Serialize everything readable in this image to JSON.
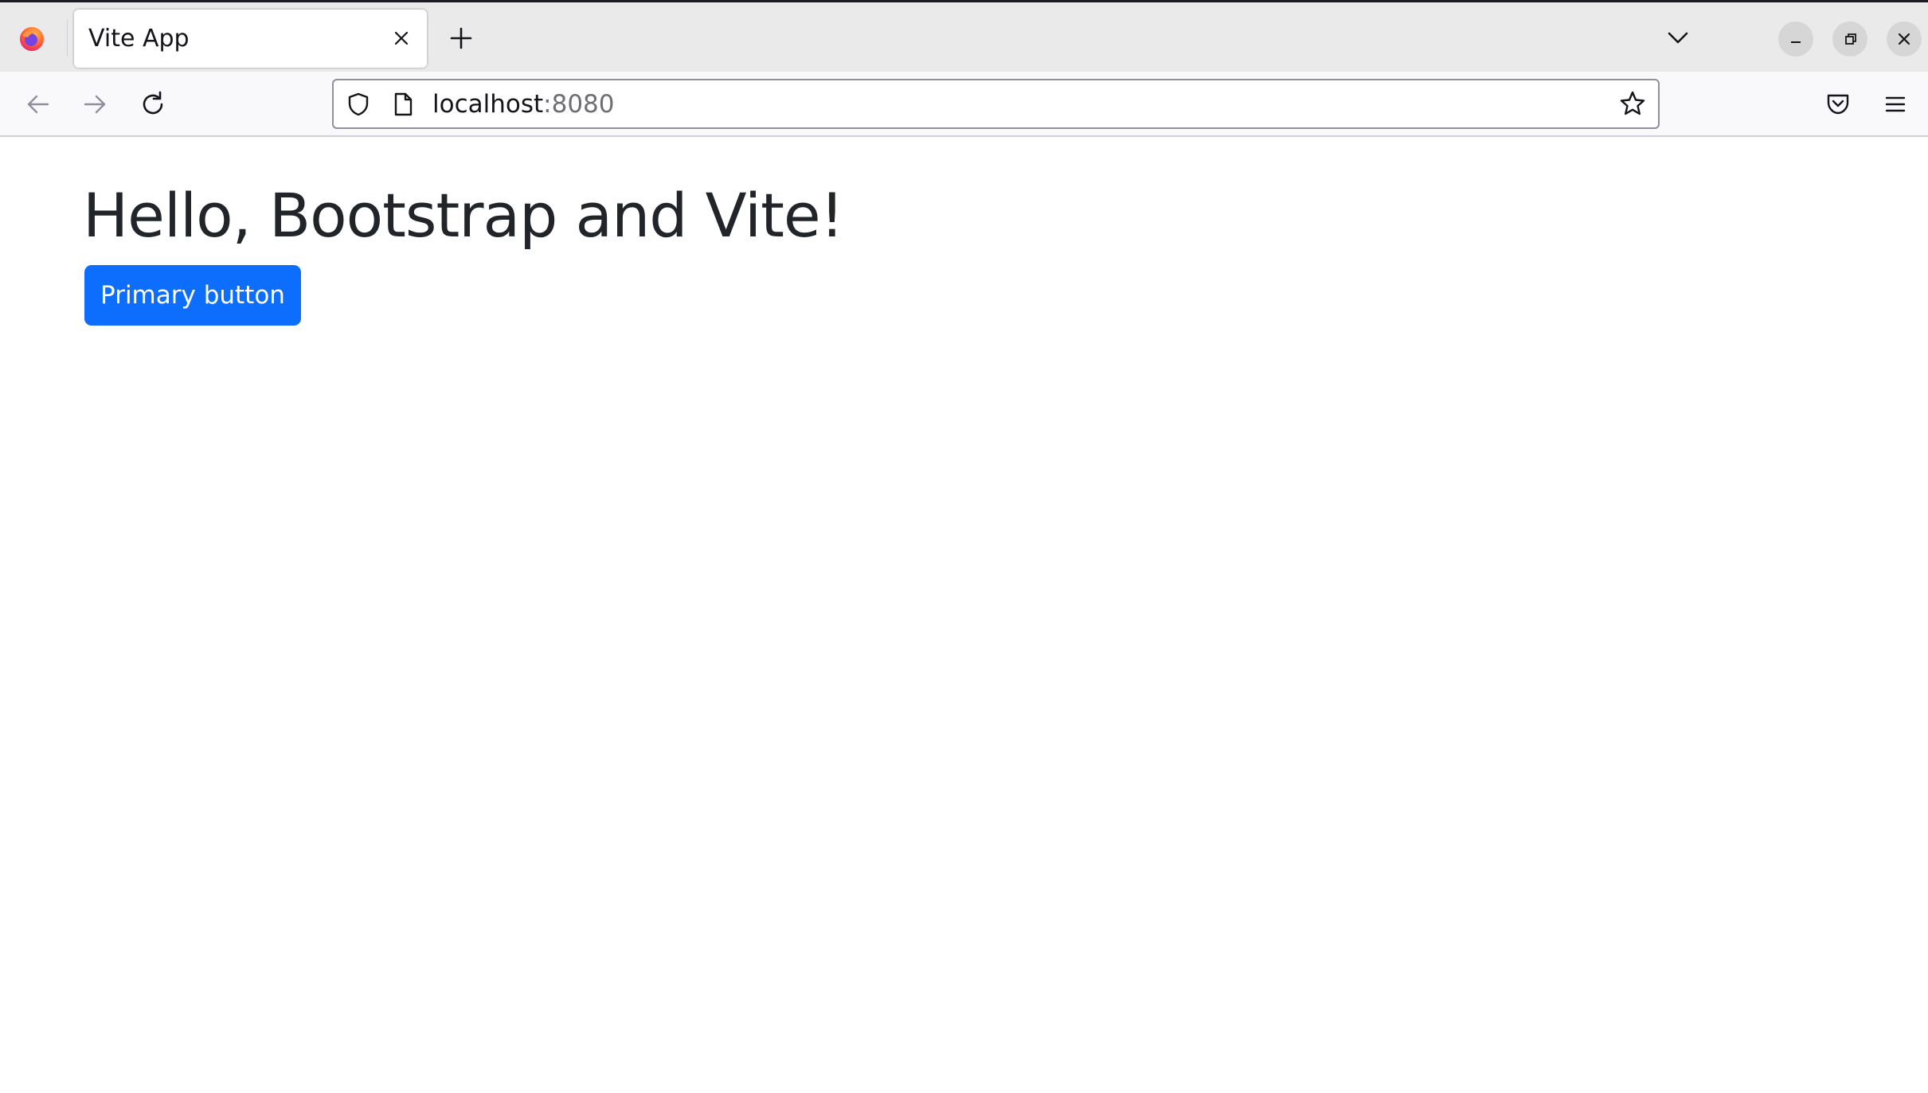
{
  "browser": {
    "tab": {
      "title": "Vite App"
    },
    "url": {
      "host": "localhost",
      "port": ":8080"
    },
    "icons": {
      "logo": "firefox-logo-icon",
      "tab_close": "close-icon",
      "new_tab": "plus-icon",
      "tab_list": "chevron-down-icon",
      "back": "arrow-left-icon",
      "forward": "arrow-right-icon",
      "reload": "reload-icon",
      "shield": "shield-icon",
      "page": "page-icon",
      "bookmark": "star-icon",
      "pocket": "pocket-icon",
      "menu": "hamburger-menu-icon",
      "minimize": "minimize-icon",
      "maximize": "restore-icon",
      "close": "close-icon"
    }
  },
  "page": {
    "heading": "Hello, Bootstrap and Vite!",
    "button_label": "Primary button"
  },
  "colors": {
    "primary": "#0d6efd",
    "heading_text": "#212529",
    "tabstrip_bg": "#eaeaea",
    "toolbar_bg": "#f9f9fb"
  }
}
